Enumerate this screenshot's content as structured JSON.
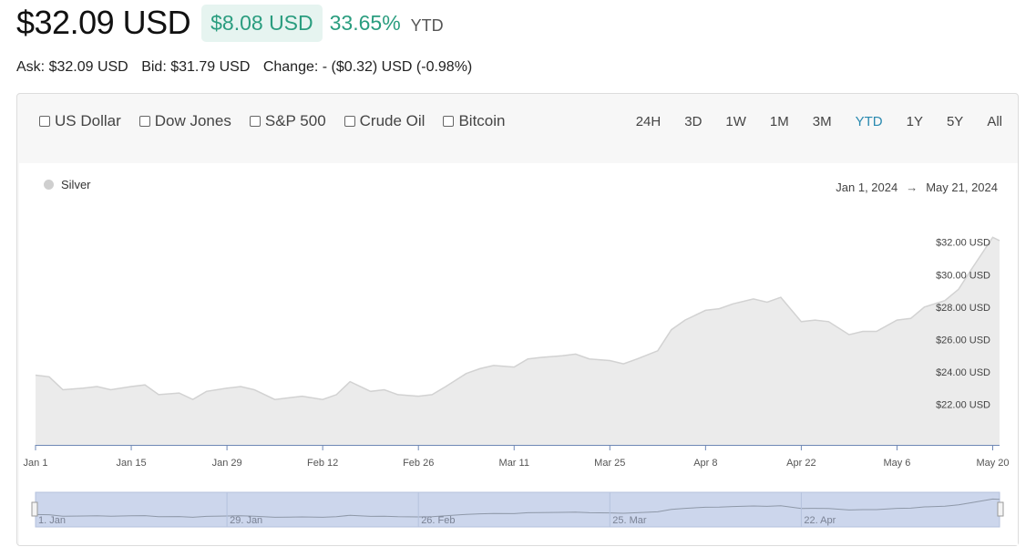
{
  "header": {
    "price": "$32.09 USD",
    "change_abs": "$8.08 USD",
    "change_pct": "33.65%",
    "period": "YTD"
  },
  "quote": {
    "ask": "Ask: $32.09 USD",
    "bid": "Bid: $31.79 USD",
    "change": "Change: - ($0.32) USD (-0.98%)"
  },
  "compare": [
    "US Dollar",
    "Dow Jones",
    "S&P 500",
    "Crude Oil",
    "Bitcoin"
  ],
  "ranges": [
    "24H",
    "3D",
    "1W",
    "1M",
    "3M",
    "YTD",
    "1Y",
    "5Y",
    "All"
  ],
  "active_range": "YTD",
  "legend": {
    "series": "Silver"
  },
  "date_range": {
    "from": "Jan 1, 2024",
    "arrow": "→",
    "to": "May 21, 2024"
  },
  "navigator_labels": [
    "1. Jan",
    "29. Jan",
    "26. Feb",
    "25. Mar",
    "22. Apr"
  ],
  "colors": {
    "accent": "#2a9d7f",
    "active_range": "#2a8ab0",
    "navigator": "#ccd6ec"
  },
  "chart_data": {
    "type": "area",
    "series": [
      {
        "name": "Silver",
        "x": [
          "2024-01-01",
          "2024-01-03",
          "2024-01-05",
          "2024-01-08",
          "2024-01-10",
          "2024-01-12",
          "2024-01-15",
          "2024-01-17",
          "2024-01-19",
          "2024-01-22",
          "2024-01-24",
          "2024-01-26",
          "2024-01-29",
          "2024-01-31",
          "2024-02-02",
          "2024-02-05",
          "2024-02-07",
          "2024-02-09",
          "2024-02-12",
          "2024-02-14",
          "2024-02-16",
          "2024-02-19",
          "2024-02-21",
          "2024-02-23",
          "2024-02-26",
          "2024-02-28",
          "2024-03-01",
          "2024-03-04",
          "2024-03-06",
          "2024-03-08",
          "2024-03-11",
          "2024-03-13",
          "2024-03-15",
          "2024-03-18",
          "2024-03-20",
          "2024-03-22",
          "2024-03-25",
          "2024-03-27",
          "2024-03-29",
          "2024-04-01",
          "2024-04-03",
          "2024-04-05",
          "2024-04-08",
          "2024-04-10",
          "2024-04-12",
          "2024-04-15",
          "2024-04-17",
          "2024-04-19",
          "2024-04-22",
          "2024-04-24",
          "2024-04-26",
          "2024-04-29",
          "2024-05-01",
          "2024-05-03",
          "2024-05-06",
          "2024-05-08",
          "2024-05-10",
          "2024-05-13",
          "2024-05-15",
          "2024-05-17",
          "2024-05-20",
          "2024-05-21"
        ],
        "y": [
          23.8,
          23.7,
          22.9,
          23.0,
          23.1,
          22.9,
          23.1,
          23.2,
          22.6,
          22.7,
          22.3,
          22.8,
          23.0,
          23.1,
          22.9,
          22.3,
          22.4,
          22.5,
          22.3,
          22.6,
          23.4,
          22.8,
          22.9,
          22.6,
          22.5,
          22.6,
          23.1,
          23.9,
          24.2,
          24.4,
          24.3,
          24.8,
          24.9,
          25.0,
          25.1,
          24.8,
          24.7,
          24.5,
          24.8,
          25.3,
          26.6,
          27.2,
          27.8,
          27.9,
          28.2,
          28.5,
          28.3,
          28.6,
          27.1,
          27.2,
          27.1,
          26.3,
          26.5,
          26.5,
          27.2,
          27.3,
          28.0,
          28.4,
          29.1,
          30.4,
          32.3,
          32.1
        ]
      }
    ],
    "yticks": [
      22,
      24,
      26,
      28,
      30,
      32
    ],
    "ytick_labels": [
      "$22.00 USD",
      "$24.00 USD",
      "$26.00 USD",
      "$28.00 USD",
      "$30.00 USD",
      "$32.00 USD"
    ],
    "xticks": [
      "2024-01-01",
      "2024-01-15",
      "2024-01-29",
      "2024-02-12",
      "2024-02-26",
      "2024-03-11",
      "2024-03-25",
      "2024-04-08",
      "2024-04-22",
      "2024-05-06",
      "2024-05-20"
    ],
    "xtick_labels": [
      "Jan 1",
      "Jan 15",
      "Jan 29",
      "Feb 12",
      "Feb 26",
      "Mar 11",
      "Mar 25",
      "Apr 8",
      "Apr 22",
      "May 6",
      "May 20"
    ],
    "ylim": [
      19.5,
      33.5
    ],
    "xlim": [
      "2024-01-01",
      "2024-05-21"
    ],
    "grid": false,
    "legend_position": "top-left"
  }
}
